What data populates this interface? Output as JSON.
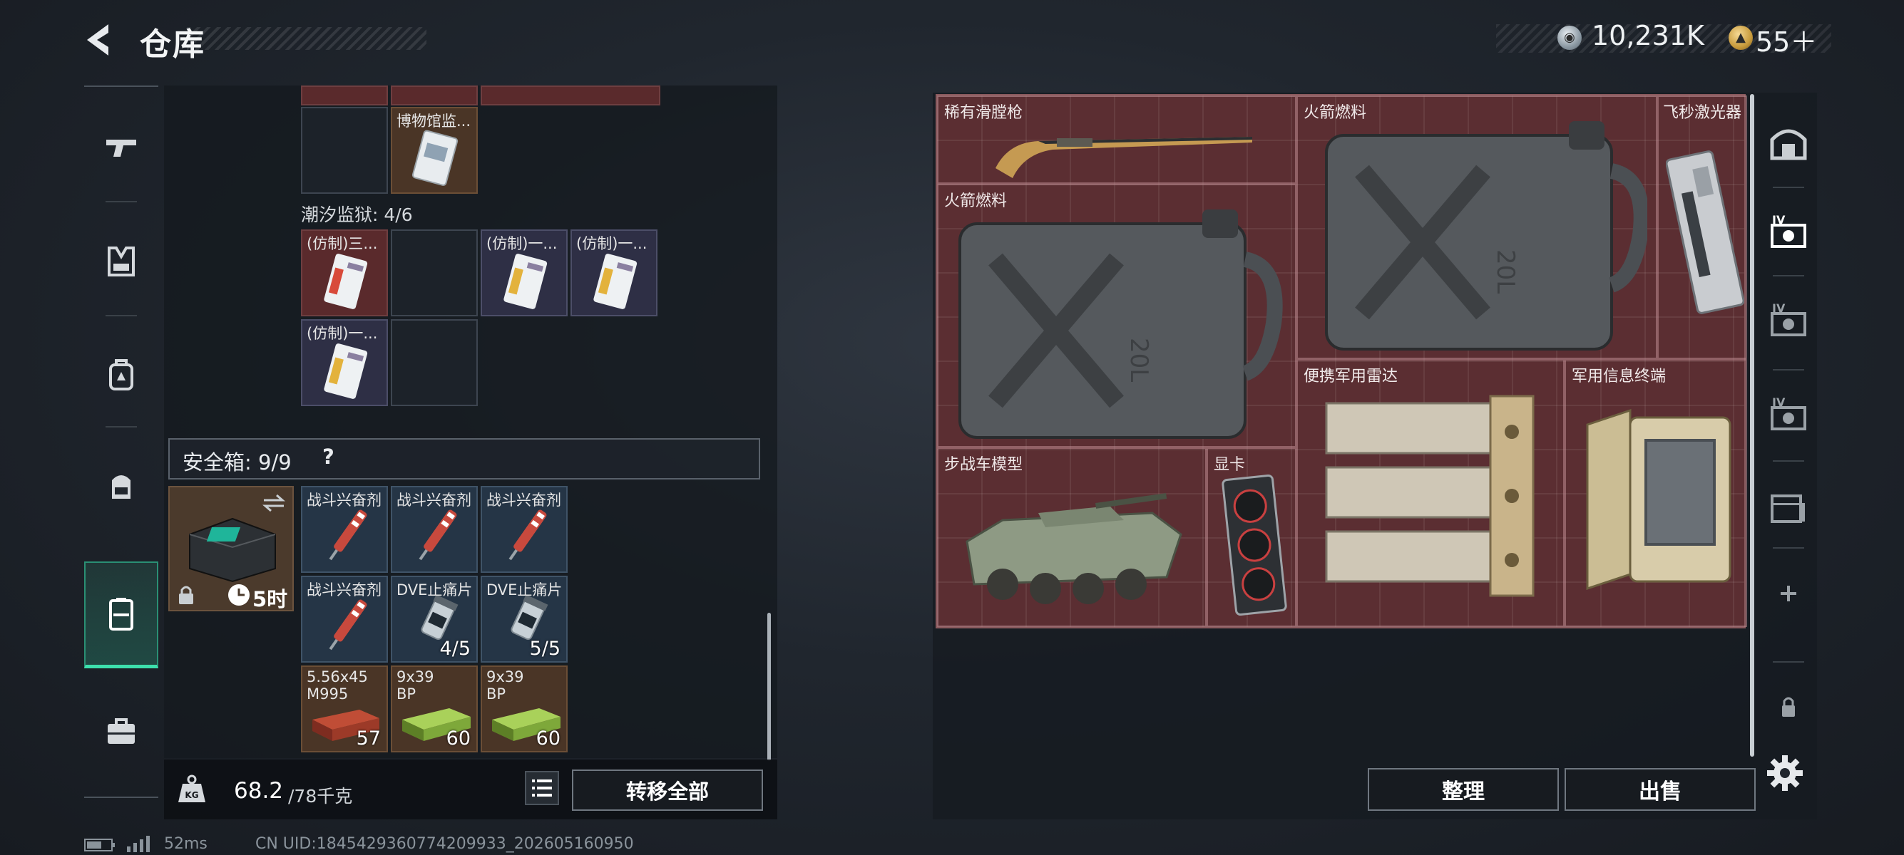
{
  "header": {
    "title": "仓库",
    "money": "10,231K",
    "gems": "55＋"
  },
  "left_nav": [
    "weapons-tab",
    "armor-tab",
    "backpack-tab",
    "rig-tab",
    "safe-box-tab",
    "toolkit-tab"
  ],
  "storage": {
    "museum_item": "博物馆监...",
    "section_title": "潮汐监狱: 4/6",
    "items": [
      {
        "label": "(仿制)三..."
      },
      {
        "label": "(仿制)一..."
      },
      {
        "label": "(仿制)一..."
      },
      {
        "label": "(仿制)一..."
      }
    ]
  },
  "safe_box": {
    "title": "安全箱: 9/9",
    "help": "?",
    "timer": "5时",
    "items": [
      {
        "label": "战斗兴奋剂",
        "count": ""
      },
      {
        "label": "战斗兴奋剂",
        "count": ""
      },
      {
        "label": "战斗兴奋剂",
        "count": ""
      },
      {
        "label": "战斗兴奋剂",
        "count": ""
      },
      {
        "label": "DVE止痛片",
        "count": "4/5"
      },
      {
        "label": "DVE止痛片",
        "count": "5/5"
      },
      {
        "label": "5.56x45\nM995",
        "count": "57"
      },
      {
        "label": "9x39\nBP",
        "count": "60"
      },
      {
        "label": "9x39\nBP",
        "count": "60"
      }
    ]
  },
  "weight": {
    "current": "68.2",
    "max": "/78千克"
  },
  "buttons": {
    "transfer_all": "转移全部",
    "sort": "整理",
    "sell": "出售"
  },
  "container_items": [
    {
      "label": "稀有滑膛枪"
    },
    {
      "label": "火箭燃料"
    },
    {
      "label": "飞秒激光器"
    },
    {
      "label": "火箭燃料"
    },
    {
      "label": "便携军用雷达"
    },
    {
      "label": "军用信息终端"
    },
    {
      "label": "步战车模型"
    },
    {
      "label": "显卡"
    }
  ],
  "status": {
    "ping": "52ms",
    "uid": "CN UID:1845429360774209933_202605160950"
  },
  "colors": {
    "accent": "#3de0ad",
    "red_rarity": "#5a2a2c",
    "purple_rarity": "#2e2f45",
    "blue_rarity": "#253546",
    "orange_rarity": "#4a3526"
  }
}
